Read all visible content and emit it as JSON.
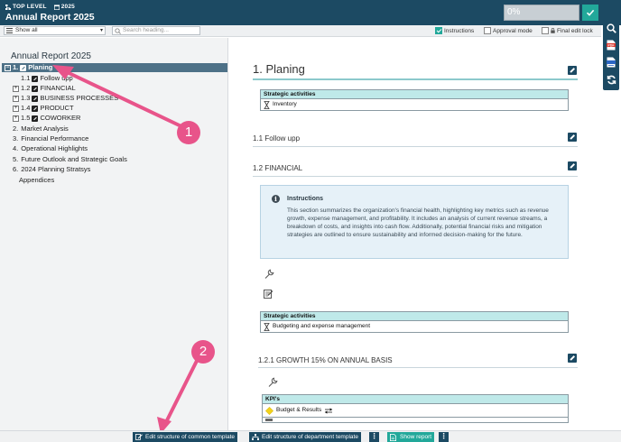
{
  "header": {
    "level_label": "TOP LEVEL",
    "year_label": "2025",
    "title": "Annual Report 2025",
    "progress_text": "0%"
  },
  "toolbar": {
    "filter_value": "Show all",
    "search_placeholder": "Search heading...",
    "options": [
      {
        "label": "Instructions",
        "checked": true
      },
      {
        "label": "Approval mode",
        "checked": false
      },
      {
        "label": "Final edit lock",
        "checked": false
      }
    ]
  },
  "right_bar": {
    "icons": [
      "search-icon",
      "pdf-icon",
      "word-icon",
      "refresh-icon"
    ],
    "pdf_text": "PDF"
  },
  "tree": {
    "title": "Annual Report 2025",
    "items": [
      {
        "num": "1.",
        "label": "Planing",
        "toggle": "−",
        "edit": true,
        "selected": true
      },
      {
        "num": "1.1",
        "label": "Follow upp",
        "toggle": "",
        "edit": true
      },
      {
        "num": "1.2",
        "label": "FINANCIAL",
        "toggle": "+",
        "edit": true
      },
      {
        "num": "1.3",
        "label": "BUSINESS PROCESSES",
        "toggle": "+",
        "edit": true
      },
      {
        "num": "1.4",
        "label": "PRODUCT",
        "toggle": "+",
        "edit": true
      },
      {
        "num": "1.5",
        "label": "COWORKER",
        "toggle": "+",
        "edit": true
      },
      {
        "num": "2.",
        "label": "Market Analysis"
      },
      {
        "num": "3.",
        "label": "Financial Performance"
      },
      {
        "num": "4.",
        "label": "Operational Highlights"
      },
      {
        "num": "5.",
        "label": "Future Outlook and Strategic Goals"
      },
      {
        "num": "6.",
        "label": "2024 Planning Stratsys"
      },
      {
        "num": "",
        "label": "Appendices"
      }
    ]
  },
  "main": {
    "h1": "1. Planing",
    "table1": {
      "header": "Strategic activities",
      "rows": [
        "Inventory"
      ]
    },
    "sec_follow": "1.1 Follow upp",
    "sec_financial": "1.2 FINANCIAL",
    "instructions": {
      "title": "Instructions",
      "body": "This section summarizes the organization's financial health, highlighting key metrics such as revenue growth, expense management, and profitability. It includes an analysis of current revenue streams, a breakdown of costs, and insights into cash flow. Additionally, potential financial risks and mitigation strategies are outlined to ensure sustainability and informed decision-making for the future."
    },
    "table2": {
      "header": "Strategic activities",
      "rows": [
        "Budgeting and expense management"
      ]
    },
    "sec_growth": "1.2.1 GROWTH 15% ON ANNUAL BASIS",
    "table3": {
      "header": "KPI's",
      "rows": [
        "Budget & Results"
      ]
    }
  },
  "annotations": {
    "badge1": "1",
    "badge2": "2"
  },
  "footer": {
    "edit_common": "Edit structure of common template",
    "edit_department": "Edit structure of department template",
    "show_report": "Show report",
    "more": "⋮"
  },
  "colors": {
    "header_bg": "#1c4a63",
    "accent": "#22a89a",
    "selected_row": "#4e7187",
    "annotation": "#e8548a"
  }
}
